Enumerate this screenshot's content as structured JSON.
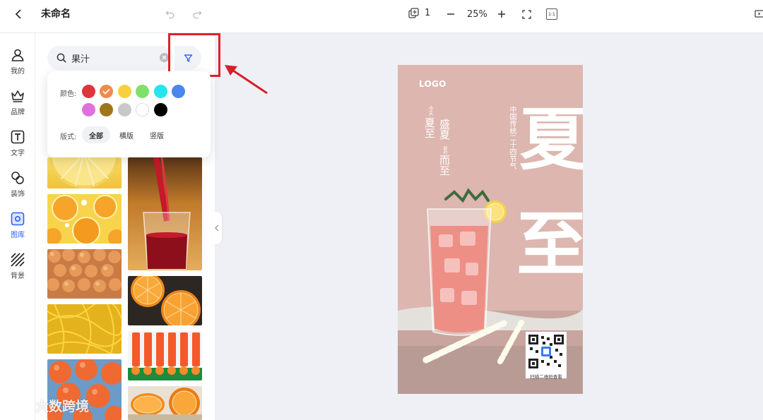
{
  "header": {
    "title": "未命名",
    "page_count": "1",
    "zoom": "25%",
    "ratio_label": "1:1"
  },
  "rail": [
    {
      "label": "我的",
      "icon": "user-icon"
    },
    {
      "label": "品牌",
      "icon": "crown-icon"
    },
    {
      "label": "文字",
      "icon": "text-icon"
    },
    {
      "label": "装饰",
      "icon": "shapes-icon"
    },
    {
      "label": "图库",
      "icon": "gallery-icon",
      "active": true
    },
    {
      "label": "背景",
      "icon": "background-icon"
    }
  ],
  "search": {
    "value": "果汁"
  },
  "filter": {
    "color_label": "颜色:",
    "colors": [
      "#e0343d",
      "#f08a4b",
      "#f8cf3e",
      "#7fe06a",
      "#21e5ef",
      "#4a86ee",
      "#e070de",
      "#a0751a",
      "#c8c8c8",
      "#ffffff",
      "#000000"
    ],
    "selected_color": "#f08a4b",
    "layout_label": "版式:",
    "layouts": [
      "全部",
      "横版",
      "竖版"
    ],
    "active_layout": "全部"
  },
  "poster": {
    "logo": "LOGO",
    "line_small_1": "今天",
    "line_big_1": "夏至",
    "line_big_2a": "盛夏",
    "line_small_2": "韵约",
    "line_big_2b": "而至",
    "line_right": "中国传统二十四节气",
    "big_char_1": "夏",
    "big_char_2": "至",
    "qr_caption": "扫描二维码查看"
  },
  "watermark": "大数跨境"
}
